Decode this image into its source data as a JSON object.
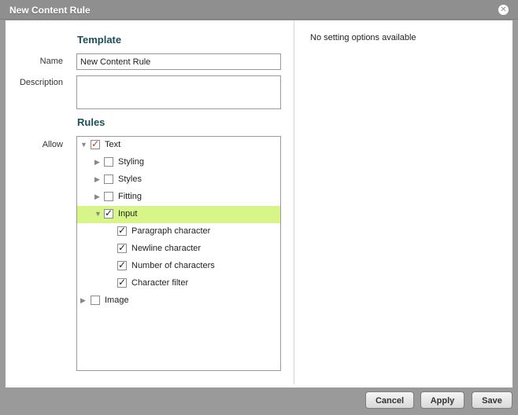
{
  "window": {
    "title": "New Content Rule"
  },
  "template": {
    "section_title": "Template",
    "name_label": "Name",
    "name_value": "New Content Rule",
    "description_label": "Description",
    "description_value": ""
  },
  "rules": {
    "section_title": "Rules",
    "allow_label": "Allow",
    "tree": [
      {
        "label": "Text",
        "expanded": true,
        "checked": true,
        "checkmark_color": "#d23a1a"
      },
      {
        "label": "Styling",
        "expanded": false,
        "checked": false
      },
      {
        "label": "Styles",
        "expanded": false,
        "checked": false
      },
      {
        "label": "Fitting",
        "expanded": false,
        "checked": false
      },
      {
        "label": "Input",
        "expanded": true,
        "checked": true,
        "highlighted": true,
        "highlight_color": "#d8f58a"
      },
      {
        "label": "Paragraph character",
        "checked": true
      },
      {
        "label": "Newline character",
        "checked": true
      },
      {
        "label": "Number of characters",
        "checked": true
      },
      {
        "label": "Character filter",
        "checked": true
      },
      {
        "label": "Image",
        "expanded": false,
        "checked": false
      }
    ]
  },
  "settings": {
    "message": "No setting options available"
  },
  "footer": {
    "cancel": "Cancel",
    "apply": "Apply",
    "save": "Save"
  }
}
